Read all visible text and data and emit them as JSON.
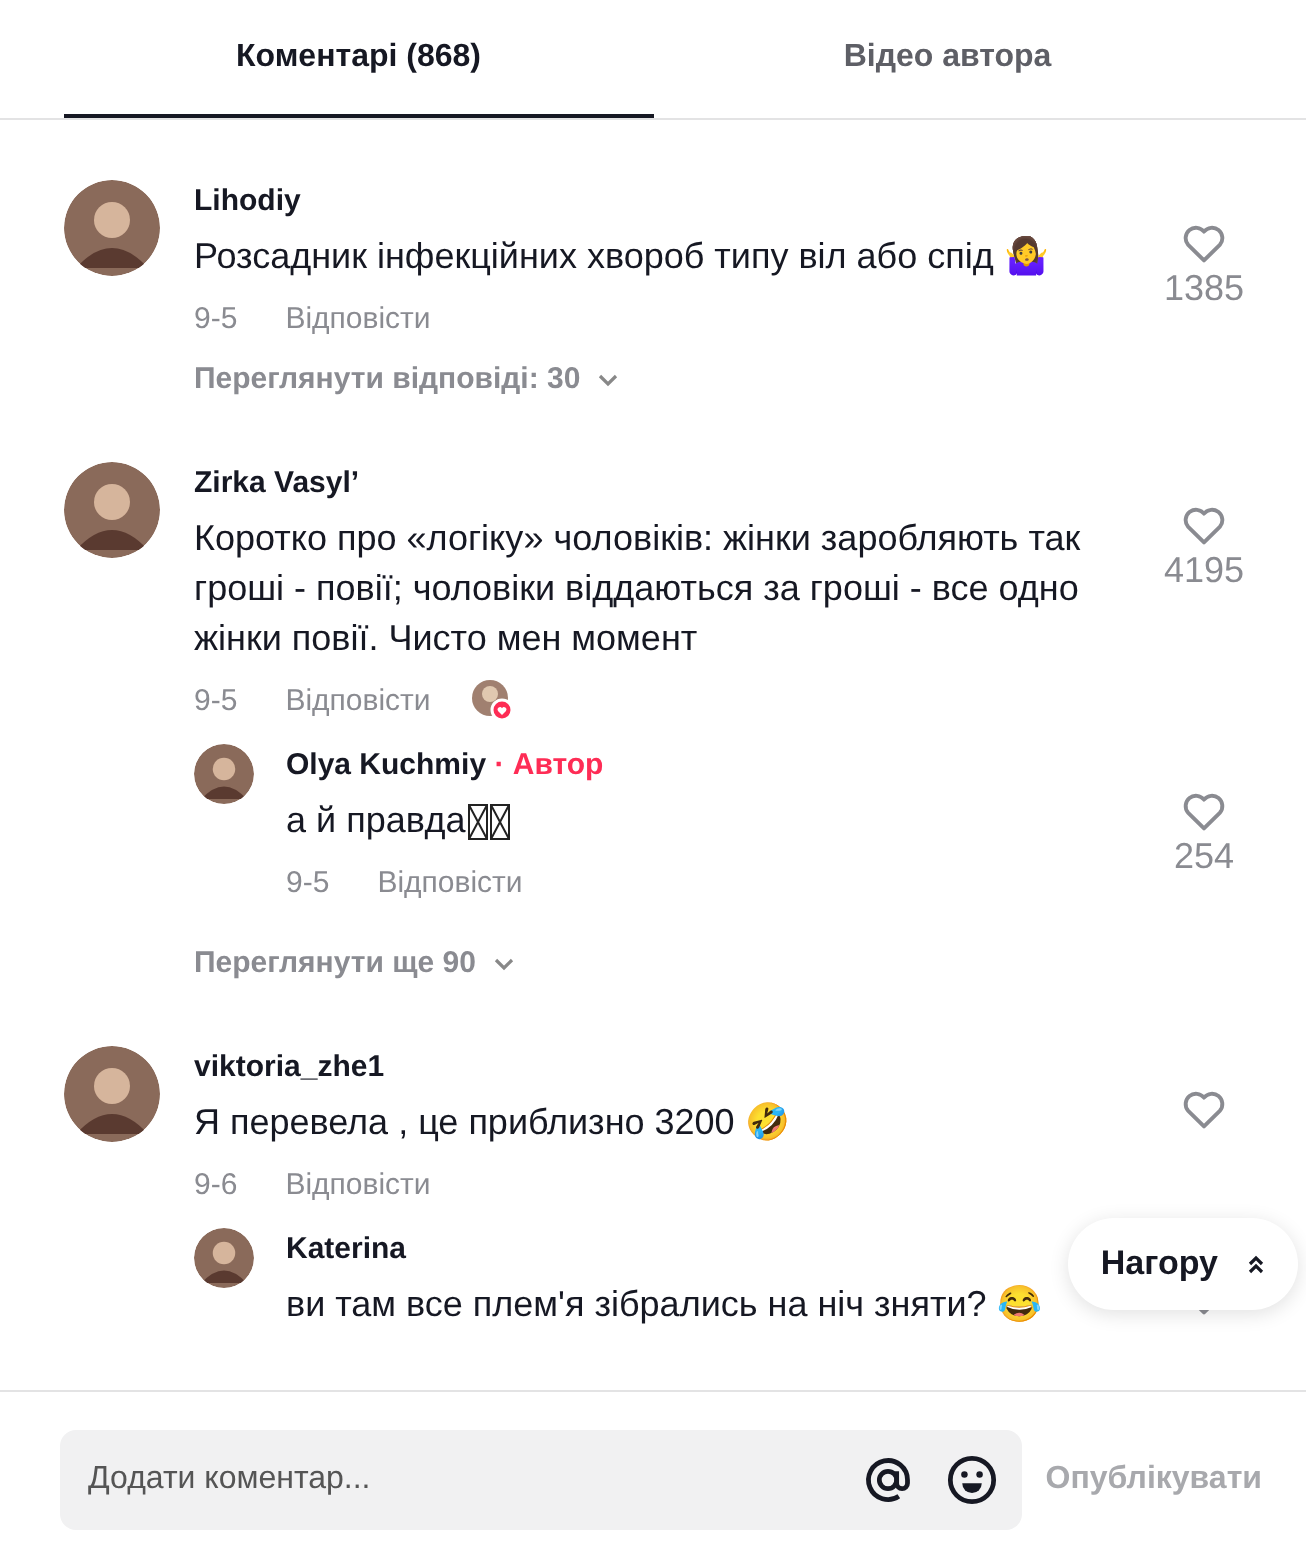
{
  "tabs": [
    {
      "label": "Коментарі (868)",
      "selected": true
    },
    {
      "label": "Відео автора",
      "selected": false
    }
  ],
  "comments": [
    {
      "author": "Lihodiy",
      "text": "Розсадник інфекційних хвороб типу віл або спід 🤷‍♀️",
      "date": "9-5",
      "reply": "Відповісти",
      "likes": "1385",
      "liked_by_author": false,
      "more": "Переглянути відповіді: 30"
    },
    {
      "author": "Zirka Vasyl’",
      "text": "Коротко про «логіку» чоловіків: жінки заробляють так гроші - повії; чоловіки віддаються за гроші - все одно жінки повії. Чисто мен момент",
      "date": "9-5",
      "reply": "Відповісти",
      "likes": "4195",
      "liked_by_author": true,
      "more": "Переглянути ще 90",
      "replies": [
        {
          "author": "Olya Kuchmiy",
          "badge": "· Автор",
          "text": "а й правда",
          "date": "9-5",
          "reply": "Відповісти",
          "likes": "254"
        }
      ]
    },
    {
      "author": "viktoria_zhe1",
      "text": "Я перевела , це приблизно 3200 🤣",
      "date": "9-6",
      "reply": "Відповісти",
      "liked_by_author": false,
      "replies": [
        {
          "author": "Katerina",
          "text": "ви там все плем'я зібрались на ніч зняти? 😂"
        }
      ]
    }
  ],
  "back_to_top": "Нагору",
  "composer": {
    "placeholder": "Додати коментар...",
    "post": "Опублікувати"
  }
}
